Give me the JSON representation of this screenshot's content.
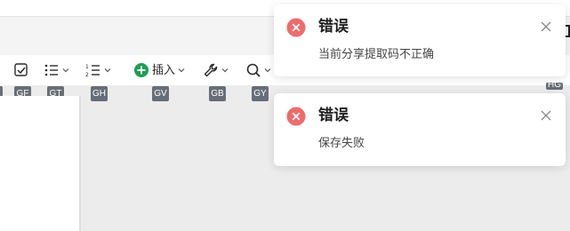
{
  "toolbar": {
    "insert_label": "插入",
    "buttons": [
      {
        "name": "checkbox",
        "icon": "checkbox-icon"
      },
      {
        "name": "bullet-list",
        "icon": "bullet-list-icon"
      },
      {
        "name": "numbered-list",
        "icon": "numbered-list-icon"
      },
      {
        "name": "insert",
        "icon": "plus-circle-icon"
      },
      {
        "name": "tools",
        "icon": "wrench-icon"
      },
      {
        "name": "search",
        "icon": "search-icon"
      }
    ]
  },
  "key_hints": [
    "GF",
    "GT",
    "GH",
    "GV",
    "GB",
    "GY",
    "HG"
  ],
  "toasts": [
    {
      "title": "错误",
      "message": "当前分享提取码不正确",
      "icon": "error-circle-icon"
    },
    {
      "title": "错误",
      "message": "保存失败",
      "icon": "error-circle-icon"
    }
  ],
  "colors": {
    "error": "#ef6b6b",
    "accent_green": "#1aa053",
    "hint_bg": "#686e76"
  }
}
